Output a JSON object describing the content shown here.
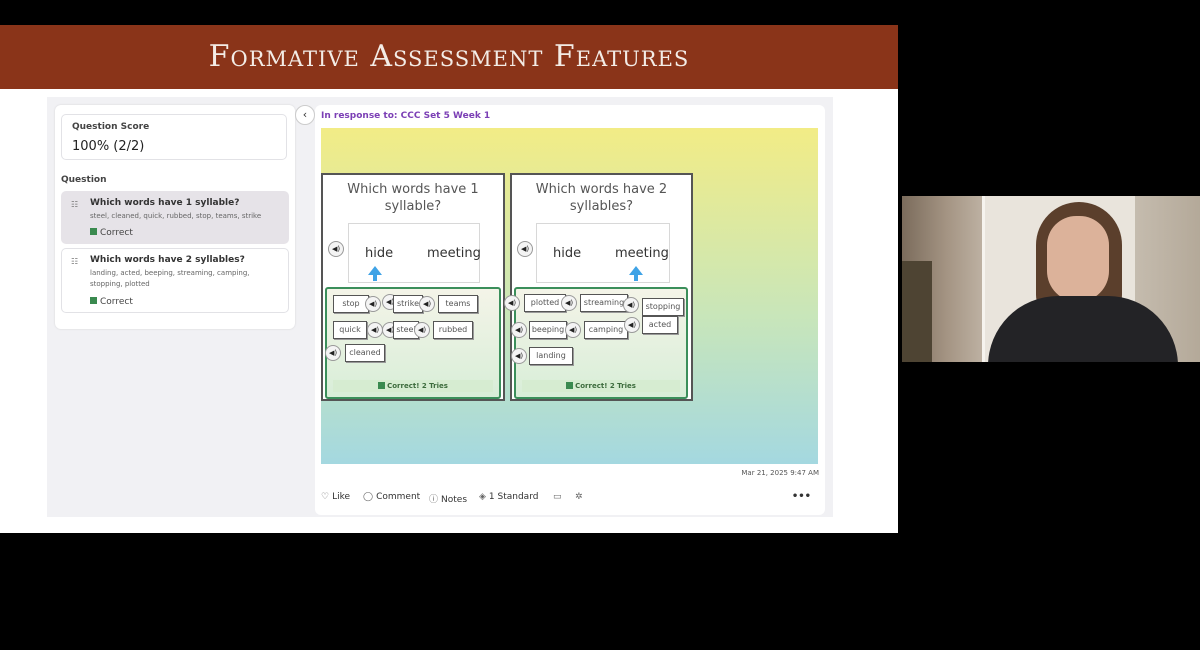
{
  "slide": {
    "title": "Formative Assessment Features"
  },
  "score": {
    "label": "Question Score",
    "value": "100% (2/2)"
  },
  "questions": {
    "heading": "Question",
    "items": [
      {
        "title": "Which words have 1 syllable?",
        "answers": "steel, cleaned, quick, rubbed, stop, teams, strike",
        "status": "Correct"
      },
      {
        "title": "Which words have 2 syllables?",
        "answers": "landing, acted, beeping, streaming, camping, stopping, plotted",
        "status": "Correct"
      }
    ]
  },
  "response": {
    "label": "In response to: CCC Set 5 Week 1"
  },
  "activity": {
    "card1": {
      "title": "Which words have 1 syllable?",
      "example_words": [
        "hide",
        "meeting"
      ],
      "tiles": [
        "stop",
        "strike",
        "teams",
        "quick",
        "steel",
        "rubbed",
        "cleaned"
      ],
      "result": "Correct! 2 Tries"
    },
    "card2": {
      "title": "Which words have 2 syllables?",
      "example_words": [
        "hide",
        "meeting"
      ],
      "tiles": [
        "plotted",
        "streaming",
        "stopping",
        "beeping",
        "camping",
        "acted",
        "landing"
      ],
      "result": "Correct! 2 Tries"
    }
  },
  "post": {
    "timestamp": "Mar 21, 2025 9:47 AM",
    "actions": {
      "like": "Like",
      "comment": "Comment",
      "notes": "Notes",
      "standard": "1 Standard",
      "more": "•••"
    }
  },
  "colors": {
    "banner": "#8a3419",
    "correct": "#3a8a4f",
    "response_label": "#7b3fb5",
    "arrow": "#3fa3e6"
  },
  "icons": [
    "chevron-left-icon",
    "speaker-icon",
    "heart-icon",
    "comment-icon",
    "notes-icon",
    "standard-icon",
    "folder-icon",
    "ai-icon",
    "more-icon",
    "checkmark-icon"
  ]
}
